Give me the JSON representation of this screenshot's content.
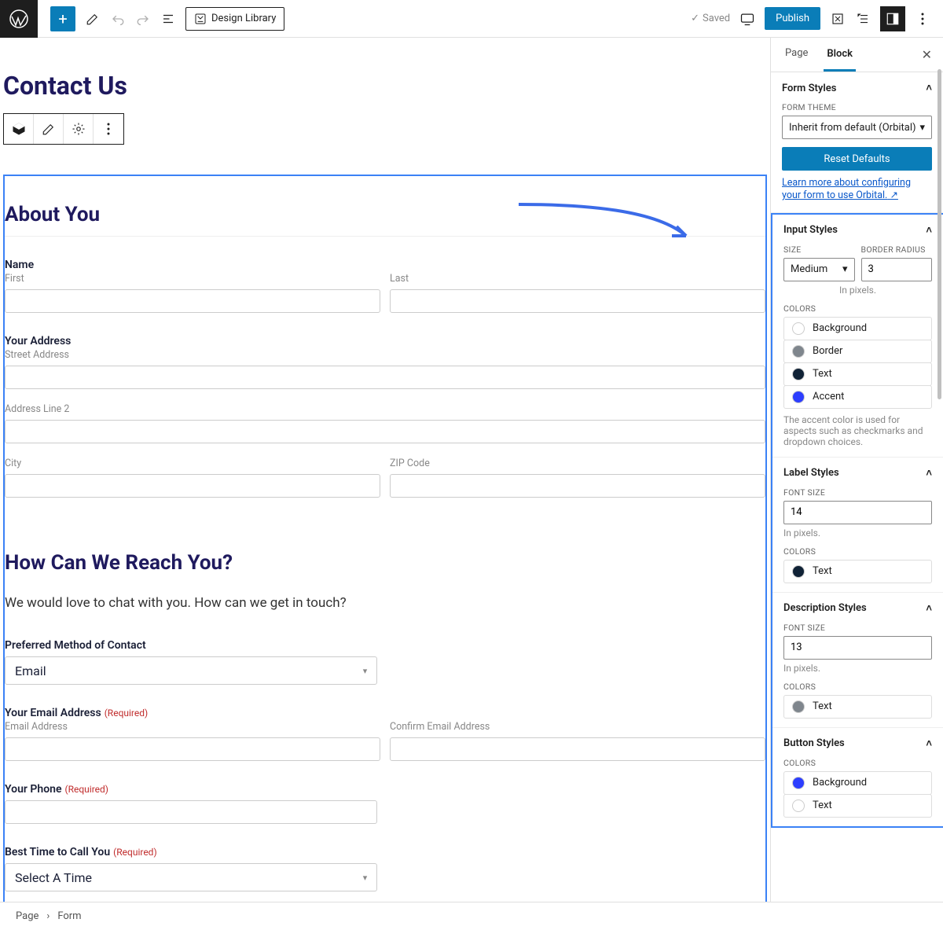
{
  "topbar": {
    "design_library": "Design Library",
    "saved": "Saved",
    "publish": "Publish"
  },
  "canvas": {
    "page_title": "Contact Us",
    "section1_heading": "About You",
    "name_label": "Name",
    "name_first": "First",
    "name_last": "Last",
    "address_label": "Your Address",
    "street": "Street Address",
    "line2": "Address Line 2",
    "city": "City",
    "zip": "ZIP Code",
    "section2_heading": "How Can We Reach You?",
    "section2_desc": "We would love to chat with you. How can we get in touch?",
    "preferred_label": "Preferred Method of Contact",
    "preferred_value": "Email",
    "email_label": "Your Email Address",
    "email_req": "(Required)",
    "email_sub": "Email Address",
    "email_confirm_sub": "Confirm Email Address",
    "phone_label": "Your Phone",
    "phone_req": "(Required)",
    "best_time_label": "Best Time to Call You",
    "best_time_req": "(Required)",
    "best_time_value": "Select A Time"
  },
  "sidebar": {
    "tabs": {
      "page": "Page",
      "block": "Block"
    },
    "form_styles": {
      "title": "Form Styles",
      "theme_label": "FORM THEME",
      "theme_value": "Inherit from default (Orbital)",
      "reset": "Reset Defaults",
      "learn_more": "Learn more about configuring your form to use Orbital."
    },
    "input_styles": {
      "title": "Input Styles",
      "size_label": "SIZE",
      "size_value": "Medium",
      "radius_label": "BORDER RADIUS",
      "radius_value": "3",
      "radius_hint": "In pixels.",
      "colors_label": "COLORS",
      "colors": [
        {
          "swatch": "#ffffff",
          "name": "Background"
        },
        {
          "swatch": "#7f868d",
          "name": "Border"
        },
        {
          "swatch": "#102236",
          "name": "Text"
        },
        {
          "swatch": "#2d3eff",
          "name": "Accent"
        }
      ],
      "accent_hint": "The accent color is used for aspects such as checkmarks and dropdown choices."
    },
    "label_styles": {
      "title": "Label Styles",
      "font_size_label": "FONT SIZE",
      "font_size_value": "14",
      "hint": "In pixels.",
      "colors_label": "COLORS",
      "colors": [
        {
          "swatch": "#102236",
          "name": "Text"
        }
      ]
    },
    "description_styles": {
      "title": "Description Styles",
      "font_size_label": "FONT SIZE",
      "font_size_value": "13",
      "hint": "In pixels.",
      "colors_label": "COLORS",
      "colors": [
        {
          "swatch": "#7f868d",
          "name": "Text"
        }
      ]
    },
    "button_styles": {
      "title": "Button Styles",
      "colors_label": "COLORS",
      "colors": [
        {
          "swatch": "#2d3eff",
          "name": "Background"
        },
        {
          "swatch": "#ffffff",
          "name": "Text"
        }
      ]
    }
  },
  "breadcrumb": {
    "page": "Page",
    "form": "Form"
  },
  "chevron_glyph": "▾",
  "chevron_up": "˄"
}
